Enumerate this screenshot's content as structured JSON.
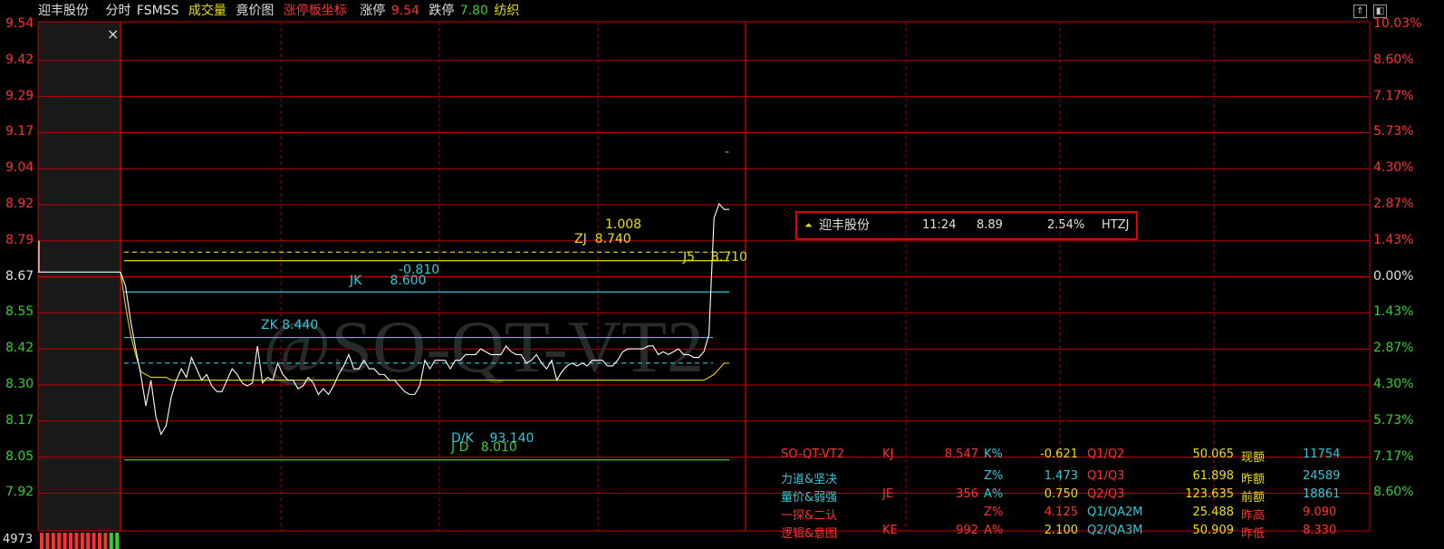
{
  "header": {
    "stock_name": "迎丰股份",
    "period": "分时",
    "formula": "FSMSS",
    "volume_label": "成交量",
    "auction_label": "竟价图",
    "limit_coord_label": "涨停板坐标",
    "limit_up_label": "涨停",
    "limit_up_value": "9.54",
    "limit_down_label": "跌停",
    "limit_down_value": "7.80",
    "industry": "纺织"
  },
  "close_icon_text": "×",
  "watermark": "@SO-QT-VT2",
  "bottom_left_value": "4973",
  "colors": {
    "background": "#000000",
    "grid": "#c00000",
    "up": "#ff3030",
    "down": "#30d030",
    "price_line": "#ffffff",
    "avg_line": "#d8c400",
    "cyan": "#30c8d8",
    "yellow": "#e8e000"
  },
  "chart_data": {
    "type": "line",
    "y_left_ticks": [
      "9.54",
      "9.42",
      "9.29",
      "9.17",
      "9.04",
      "8.92",
      "8.79",
      "8.67",
      "8.55",
      "8.42",
      "8.30",
      "8.17",
      "8.05",
      "7.92"
    ],
    "y_right_ticks": [
      "10.03%",
      "8.60%",
      "7.17%",
      "5.73%",
      "4.30%",
      "2.87%",
      "1.43%",
      "0.00%",
      "1.43%",
      "2.87%",
      "4.30%",
      "5.73%",
      "7.17%",
      "8.60%"
    ],
    "ylim": [
      7.82,
      9.54
    ],
    "prev_close": 8.67,
    "auction_price": [
      8.67,
      8.67,
      8.67,
      8.67,
      8.67
    ],
    "price": [
      8.67,
      8.62,
      8.5,
      8.4,
      8.31,
      8.2,
      8.29,
      8.16,
      8.1,
      8.13,
      8.23,
      8.29,
      8.33,
      8.3,
      8.37,
      8.33,
      8.29,
      8.31,
      8.27,
      8.25,
      8.25,
      8.29,
      8.33,
      8.31,
      8.28,
      8.27,
      8.28,
      8.41,
      8.28,
      8.3,
      8.29,
      8.35,
      8.31,
      8.29,
      8.29,
      8.26,
      8.27,
      8.3,
      8.28,
      8.24,
      8.26,
      8.24,
      8.27,
      8.31,
      8.34,
      8.38,
      8.33,
      8.33,
      8.36,
      8.33,
      8.33,
      8.31,
      8.31,
      8.29,
      8.29,
      8.27,
      8.25,
      8.24,
      8.24,
      8.27,
      8.36,
      8.33,
      8.36,
      8.36,
      8.36,
      8.33,
      8.36,
      8.36,
      8.38,
      8.38,
      8.38,
      8.4,
      8.39,
      8.38,
      8.38,
      8.38,
      8.41,
      8.39,
      8.38,
      8.38,
      8.35,
      8.36,
      8.38,
      8.35,
      8.33,
      8.36,
      8.29,
      8.32,
      8.34,
      8.35,
      8.34,
      8.35,
      8.34,
      8.36,
      8.36,
      8.36,
      8.34,
      8.34,
      8.36,
      8.39,
      8.4,
      8.4,
      8.4,
      8.4,
      8.41,
      8.41,
      8.38,
      8.39,
      8.38,
      8.39,
      8.4,
      8.38,
      8.38,
      8.37,
      8.37,
      8.39,
      8.45,
      8.86,
      8.91,
      8.89,
      8.89
    ],
    "avg": [
      8.67,
      8.55,
      8.45,
      8.38,
      8.32,
      8.31,
      8.3,
      8.3,
      8.3,
      8.3,
      8.29,
      8.29,
      8.29,
      8.29,
      8.29,
      8.29,
      8.29,
      8.29,
      8.29,
      8.29,
      8.29,
      8.29,
      8.29,
      8.29,
      8.29,
      8.29,
      8.29,
      8.29,
      8.29,
      8.29,
      8.29,
      8.29,
      8.29,
      8.29,
      8.29,
      8.29,
      8.29,
      8.29,
      8.29,
      8.29,
      8.29,
      8.29,
      8.29,
      8.29,
      8.29,
      8.29,
      8.29,
      8.29,
      8.29,
      8.29,
      8.29,
      8.29,
      8.29,
      8.29,
      8.29,
      8.29,
      8.29,
      8.29,
      8.29,
      8.29,
      8.29,
      8.29,
      8.29,
      8.29,
      8.29,
      8.29,
      8.29,
      8.29,
      8.29,
      8.29,
      8.29,
      8.29,
      8.29,
      8.29,
      8.29,
      8.29,
      8.29,
      8.29,
      8.29,
      8.29,
      8.29,
      8.29,
      8.29,
      8.29,
      8.29,
      8.29,
      8.29,
      8.29,
      8.29,
      8.29,
      8.29,
      8.29,
      8.29,
      8.29,
      8.29,
      8.29,
      8.29,
      8.29,
      8.29,
      8.29,
      8.29,
      8.29,
      8.29,
      8.29,
      8.29,
      8.29,
      8.29,
      8.29,
      8.29,
      8.29,
      8.29,
      8.29,
      8.29,
      8.29,
      8.29,
      8.29,
      8.3,
      8.31,
      8.33,
      8.35,
      8.35
    ],
    "levels": [
      {
        "name": "ZJ",
        "value": 8.74,
        "style": "dashed",
        "color": "#e8e000",
        "label": "ZJ  8.740"
      },
      {
        "name": "J5",
        "value": 8.71,
        "style": "solid",
        "color": "#e8e000",
        "label": "J5    8.710"
      },
      {
        "name": "JK",
        "value": 8.6,
        "style": "solid",
        "color": "#30c8d8",
        "label": "JK       8.600"
      },
      {
        "name": "ZK",
        "value": 8.44,
        "style": "solid",
        "color": "#30c8d8",
        "label": "ZK 8.440"
      },
      {
        "name": "DK_line",
        "value": 8.35,
        "style": "dashed",
        "color": "#30c8d8",
        "label": ""
      },
      {
        "name": "JD",
        "value": 8.01,
        "style": "solid",
        "color": "#30d030",
        "label": "J D   8.010"
      }
    ],
    "annotations": [
      {
        "text": "1.008",
        "color": "#e8e000"
      },
      {
        "text": "-0.810",
        "color": "#30c8d8"
      },
      {
        "text": "D/K    93.140",
        "color": "#30c8d8"
      },
      {
        "text": "-",
        "color": "#30c8d8"
      }
    ]
  },
  "tooltip": {
    "name": "迎丰股份",
    "time": "11:24",
    "price": "8.89",
    "change": "2.54%",
    "tag": "HTZJ"
  },
  "indicator_table": [
    [
      {
        "t": "SO-QT-VT2",
        "c": "#ff3030"
      },
      {
        "t": "KJ",
        "c": "#ff3030"
      },
      {
        "t": "8.547",
        "c": "#ff3030"
      },
      {
        "t": "K%",
        "c": "#30c8d8"
      },
      {
        "t": "-0.621",
        "c": "#e8e000"
      },
      {
        "t": "Q1/Q2",
        "c": "#ff3030"
      },
      {
        "t": "50.065",
        "c": "#e8e000"
      },
      {
        "t": "现额",
        "c": "#e8e000"
      },
      {
        "t": "11754",
        "c": "#30c8d8"
      }
    ],
    [
      {
        "t": "力道&坚决",
        "c": "#30c8d8"
      },
      {
        "t": "",
        "c": "#ff3030"
      },
      {
        "t": "",
        "c": "#ff3030"
      },
      {
        "t": "Z%",
        "c": "#30c8d8"
      },
      {
        "t": "1.473",
        "c": "#30c8d8"
      },
      {
        "t": "Q1/Q3",
        "c": "#ff3030"
      },
      {
        "t": "61.898",
        "c": "#e8e000"
      },
      {
        "t": "昨额",
        "c": "#e8e000"
      },
      {
        "t": "24589",
        "c": "#30c8d8"
      }
    ],
    [
      {
        "t": "量价&弱强",
        "c": "#30c8d8"
      },
      {
        "t": "JE",
        "c": "#ff3030"
      },
      {
        "t": "356",
        "c": "#ff3030"
      },
      {
        "t": "A%",
        "c": "#30c8d8"
      },
      {
        "t": "0.750",
        "c": "#e8e000"
      },
      {
        "t": "Q2/Q3",
        "c": "#ff3030"
      },
      {
        "t": "123.635",
        "c": "#e8e000"
      },
      {
        "t": "前额",
        "c": "#e8e000"
      },
      {
        "t": "18861",
        "c": "#30c8d8"
      }
    ],
    [
      {
        "t": "一探&二认",
        "c": "#ff3030"
      },
      {
        "t": "",
        "c": "#ff3030"
      },
      {
        "t": "",
        "c": "#ff3030"
      },
      {
        "t": "Z%",
        "c": "#ff3030"
      },
      {
        "t": "4.125",
        "c": "#ff3030"
      },
      {
        "t": "Q1/QA2M",
        "c": "#30c8d8"
      },
      {
        "t": "25.488",
        "c": "#e8e000"
      },
      {
        "t": "昨高",
        "c": "#ff3030"
      },
      {
        "t": "9.090",
        "c": "#ff3030"
      }
    ],
    [
      {
        "t": "逻辑&意图",
        "c": "#ff3030"
      },
      {
        "t": "KE",
        "c": "#ff3030"
      },
      {
        "t": "992",
        "c": "#ff3030"
      },
      {
        "t": "A%",
        "c": "#ff3030"
      },
      {
        "t": "2.100",
        "c": "#e8e000"
      },
      {
        "t": "Q2/QA3M",
        "c": "#30c8d8"
      },
      {
        "t": "50.909",
        "c": "#e8e000"
      },
      {
        "t": "昨低",
        "c": "#ff3030"
      },
      {
        "t": "8.330",
        "c": "#ff3030"
      }
    ]
  ]
}
